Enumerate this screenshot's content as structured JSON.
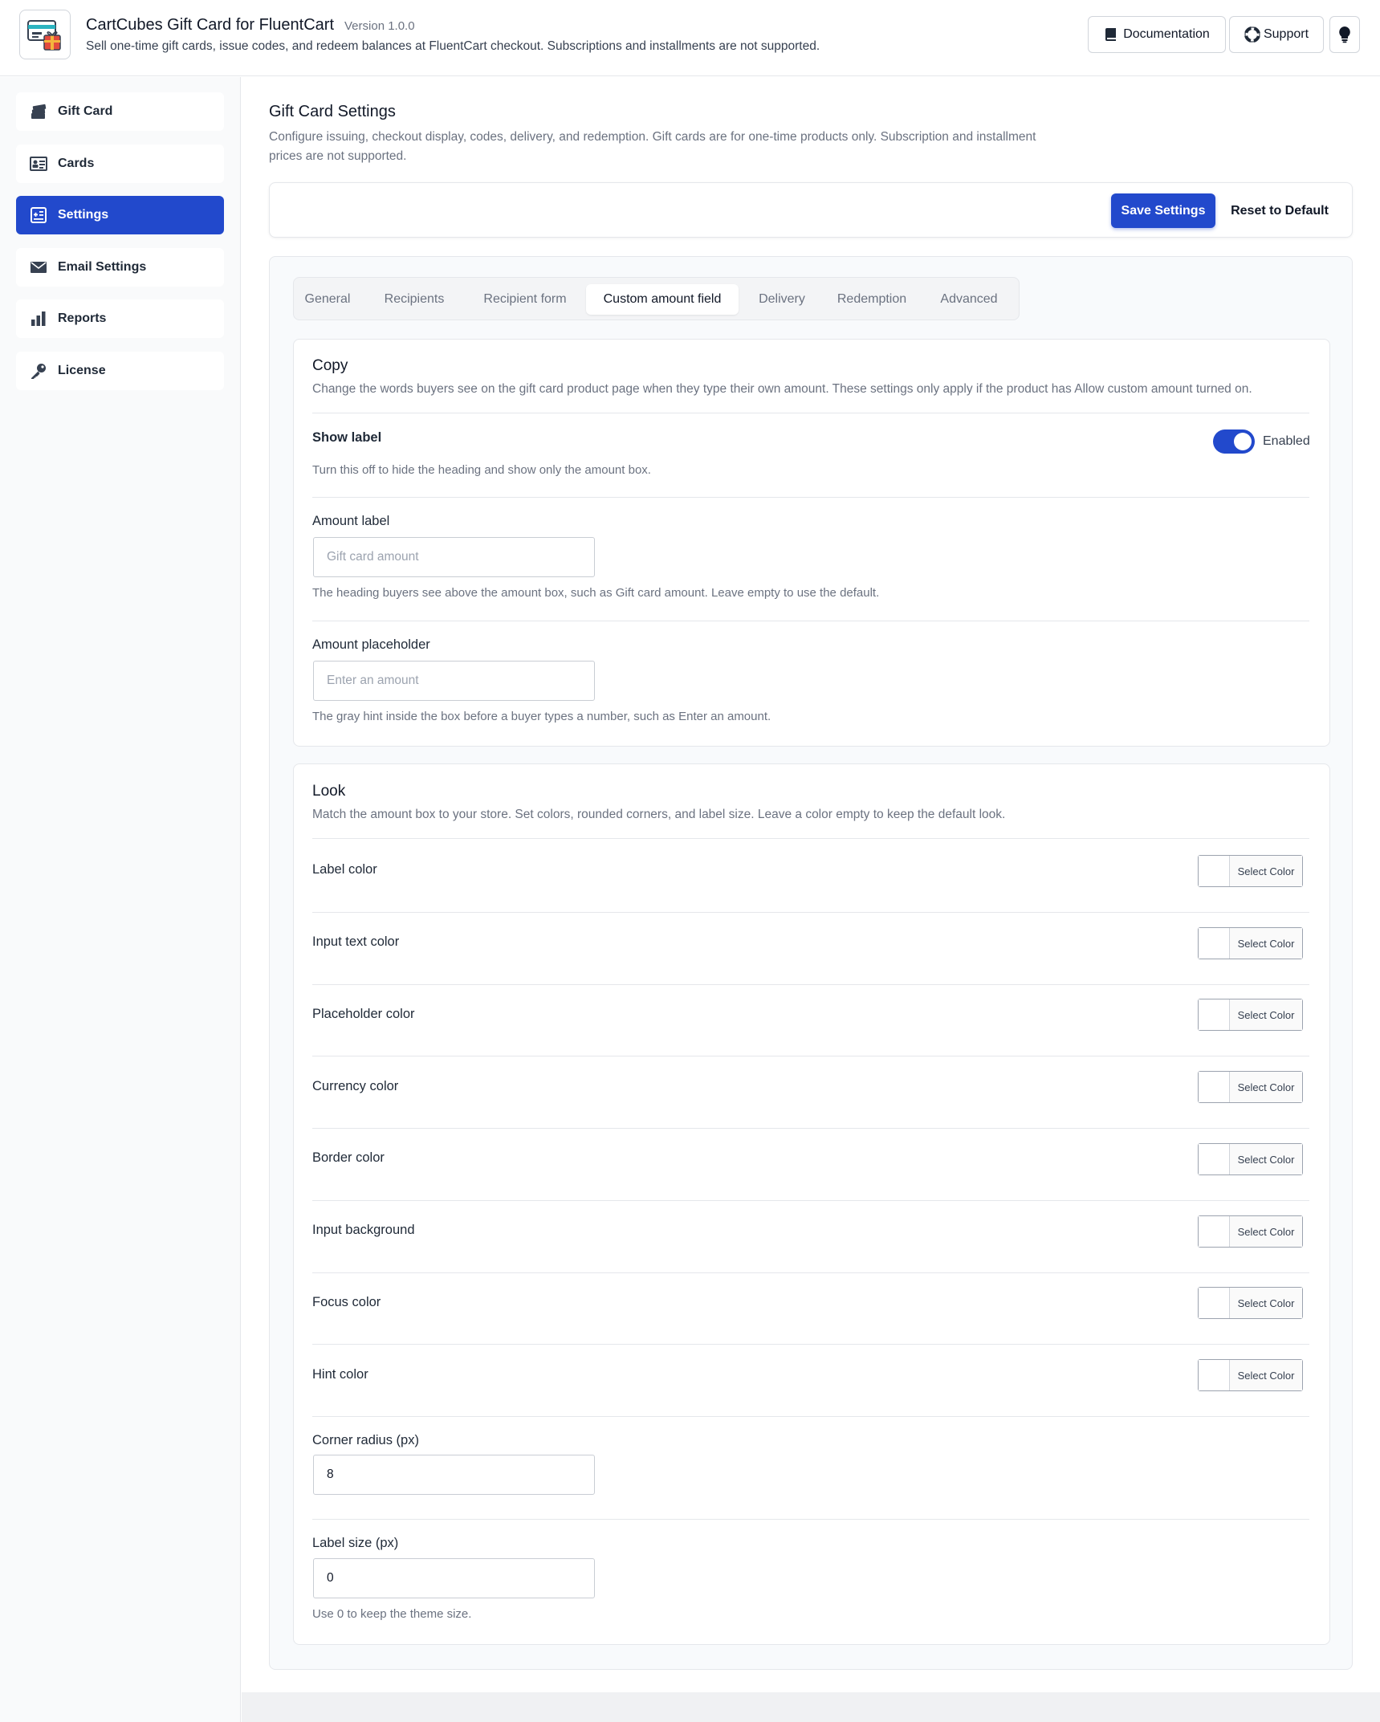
{
  "header": {
    "title": "CartCubes Gift Card for FluentCart",
    "version": "Version 1.0.0",
    "description": "Sell one-time gift cards, issue codes, and redeem balances at FluentCart checkout. Subscriptions and installments are not supported.",
    "documentation_label": "Documentation",
    "support_label": "Support"
  },
  "sidebar": {
    "items": [
      {
        "label": "Gift Card",
        "icon": "gift-card-stack-icon"
      },
      {
        "label": "Cards",
        "icon": "id-card-icon"
      },
      {
        "label": "Settings",
        "icon": "settings-plus-icon"
      },
      {
        "label": "Email Settings",
        "icon": "envelope-icon"
      },
      {
        "label": "Reports",
        "icon": "bar-chart-icon"
      },
      {
        "label": "License",
        "icon": "key-icon"
      }
    ]
  },
  "page": {
    "title": "Gift Card Settings",
    "description": "Configure issuing, checkout display, codes, delivery, and redemption. Gift cards are for one-time products only. Subscription and installment prices are not supported.",
    "save_label": "Save Settings",
    "reset_label": "Reset to Default"
  },
  "tabs": [
    "General",
    "Recipients",
    "Recipient form",
    "Custom amount field",
    "Delivery",
    "Redemption",
    "Advanced"
  ],
  "copy_section": {
    "title": "Copy",
    "description": "Change the words buyers see on the gift card product page when they type their own amount. These settings only apply if the product has Allow custom amount turned on.",
    "show_label": {
      "label": "Show label",
      "help": "Turn this off to hide the heading and show only the amount box.",
      "state": "Enabled",
      "enabled": true
    },
    "amount_label": {
      "label": "Amount label",
      "placeholder": "Gift card amount",
      "value": "",
      "help": "The heading buyers see above the amount box, such as Gift card amount. Leave empty to use the default."
    },
    "amount_placeholder": {
      "label": "Amount placeholder",
      "placeholder": "Enter an amount",
      "value": "",
      "help": "The gray hint inside the box before a buyer types a number, such as Enter an amount."
    }
  },
  "look_section": {
    "title": "Look",
    "description": "Match the amount box to your store. Set colors, rounded corners, and label size. Leave a color empty to keep the default look.",
    "select_color_label": "Select Color",
    "colors": [
      "Label color",
      "Input text color",
      "Placeholder color",
      "Currency color",
      "Border color",
      "Input background",
      "Focus color",
      "Hint color"
    ],
    "corner_radius": {
      "label": "Corner radius (px)",
      "value": "8"
    },
    "label_size": {
      "label": "Label size (px)",
      "value": "0",
      "help": "Use 0 to keep the theme size."
    }
  },
  "colors": {
    "accent": "#2249cc",
    "border": "#e5e7eb",
    "muted_text": "#6b7280"
  }
}
